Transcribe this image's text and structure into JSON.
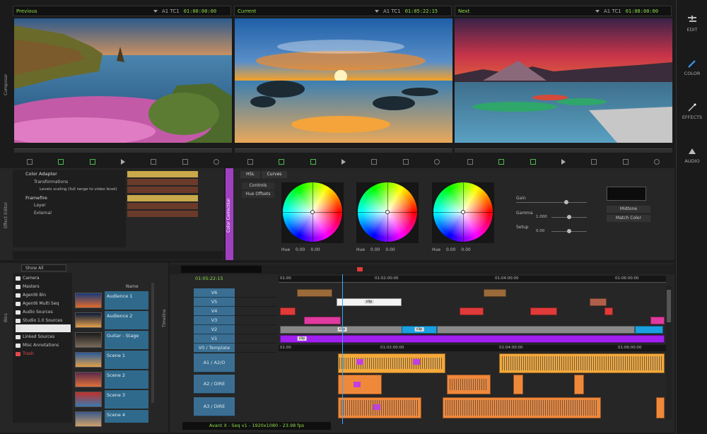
{
  "monitors": [
    {
      "name": "Previous",
      "tc_label": "A1 TC1",
      "tc": "01:00:00:00"
    },
    {
      "name": "Current",
      "tc_label": "A1 TC1",
      "tc": "01:05:22:15"
    },
    {
      "name": "Next",
      "tc_label": "A1 TC1",
      "tc": "01:08:00:00"
    }
  ],
  "sidebar": [
    {
      "label": "EDIT",
      "icon": "edit-icon"
    },
    {
      "label": "COLOR",
      "icon": "eyedropper-icon"
    },
    {
      "label": "EFFECTS",
      "icon": "wand-icon"
    },
    {
      "label": "AUDIO",
      "icon": "audio-icon"
    }
  ],
  "side_tabs": {
    "composer": "Composer",
    "effect_editor": "Effect Editor",
    "color_correction": "Color Correction",
    "bins": "Bins",
    "timeline": "Timeline"
  },
  "effects": {
    "items": [
      "Color Adapter",
      "Transformations",
      "Levels scaling (full range to video level)",
      "Framefire",
      "Layer",
      "External"
    ]
  },
  "color": {
    "tabs": [
      "HSL",
      "Curves"
    ],
    "modes": [
      "Controls",
      "Hue Offsets"
    ],
    "wheel_labels": [
      "Hue",
      "Hue",
      "Hue"
    ],
    "wheel_values": [
      [
        "0.00",
        "0.00"
      ],
      [
        "0.00",
        "0.00"
      ],
      [
        "0.00",
        "0.00"
      ]
    ],
    "sliders": [
      {
        "label": "Gain",
        "value": ""
      },
      {
        "label": "Gamma",
        "value": "1.000"
      },
      {
        "label": "Setup",
        "value": "0.00"
      }
    ],
    "buttons": [
      "Midtone",
      "Match Color"
    ]
  },
  "bins": {
    "dropdown": "Show All",
    "folders": [
      "Camera",
      "Masters",
      "Agent6 Bin",
      "Agent6 Multi Seq",
      "Audio Sources",
      "Studio 1.0 Sources",
      "",
      "Linked Sources",
      "Misc Annotations",
      "Trash"
    ],
    "name_header": "Name",
    "clips": [
      "Audience 1",
      "Audience 2",
      "Guitar - Stage",
      "Scene 1",
      "Scene 2",
      "Scene 3",
      "Scene 4"
    ]
  },
  "timeline": {
    "timecode": "01:05:22:15",
    "ruler": [
      "01:00",
      "01:02:00:00",
      "01:04:00:00",
      "01:06:00:00"
    ],
    "ruler2": [
      "01:00",
      "01:02:00:00",
      "01:04:00:00",
      "01:06:00:00"
    ],
    "video_tracks": [
      "V6",
      "V5",
      "V4",
      "V3",
      "V2",
      "V1"
    ],
    "title_track": "V0 / Template",
    "audio_tracks": [
      "A1 / A2/O",
      "A2 / DIRE",
      "A3 / DIRE"
    ],
    "clip_labels": [
      "clip",
      "clip",
      "clip",
      "clip"
    ]
  },
  "status": "Avant X - Seq v1 - 1920x1080 - 23.98 fps",
  "colors": {
    "accent": "#8fdc4a",
    "track": "#3a6f93",
    "audio_clip": "#f5a93a",
    "purple": "#a020f0"
  }
}
